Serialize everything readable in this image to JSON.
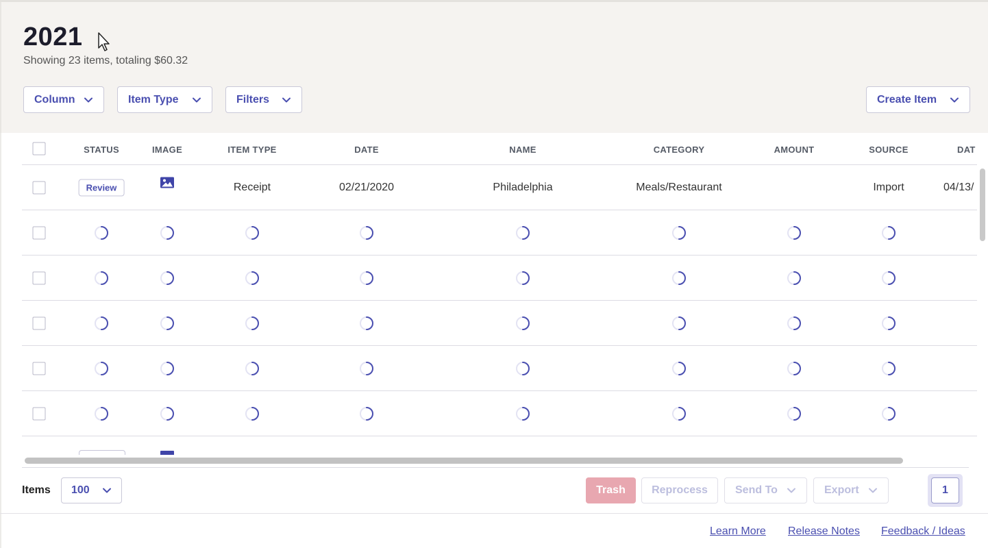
{
  "header": {
    "title": "2021",
    "subtitle": "Showing 23 items, totaling $60.32"
  },
  "toolbar": {
    "column_label": "Column",
    "item_type_label": "Item Type",
    "filters_label": "Filters",
    "create_item_label": "Create Item"
  },
  "table": {
    "columns": [
      "STATUS",
      "IMAGE",
      "ITEM TYPE",
      "DATE",
      "NAME",
      "CATEGORY",
      "AMOUNT",
      "SOURCE",
      "DAT"
    ],
    "rows": [
      {
        "status": "Review",
        "image_icon": "image-icon",
        "item_type": "Receipt",
        "date": "02/21/2020",
        "name": "Philadelphia",
        "category": "Meals/Restaurant",
        "amount": "",
        "source": "Import",
        "date_extra": "04/13/"
      }
    ],
    "loading_rows": 5,
    "loading_indicator": "spinner-icon"
  },
  "footer_bar": {
    "items_label": "Items",
    "per_page": "100",
    "trash_label": "Trash",
    "reprocess_label": "Reprocess",
    "send_to_label": "Send To",
    "export_label": "Export",
    "current_page": "1"
  },
  "links": {
    "learn_more": "Learn More",
    "release_notes": "Release Notes",
    "feedback": "Feedback / Ideas"
  },
  "colors": {
    "accent": "#4a4fb0",
    "header_bg": "#f5f3f0",
    "trash_bg": "#e8a7b0",
    "disabled_text": "#bcbede"
  }
}
